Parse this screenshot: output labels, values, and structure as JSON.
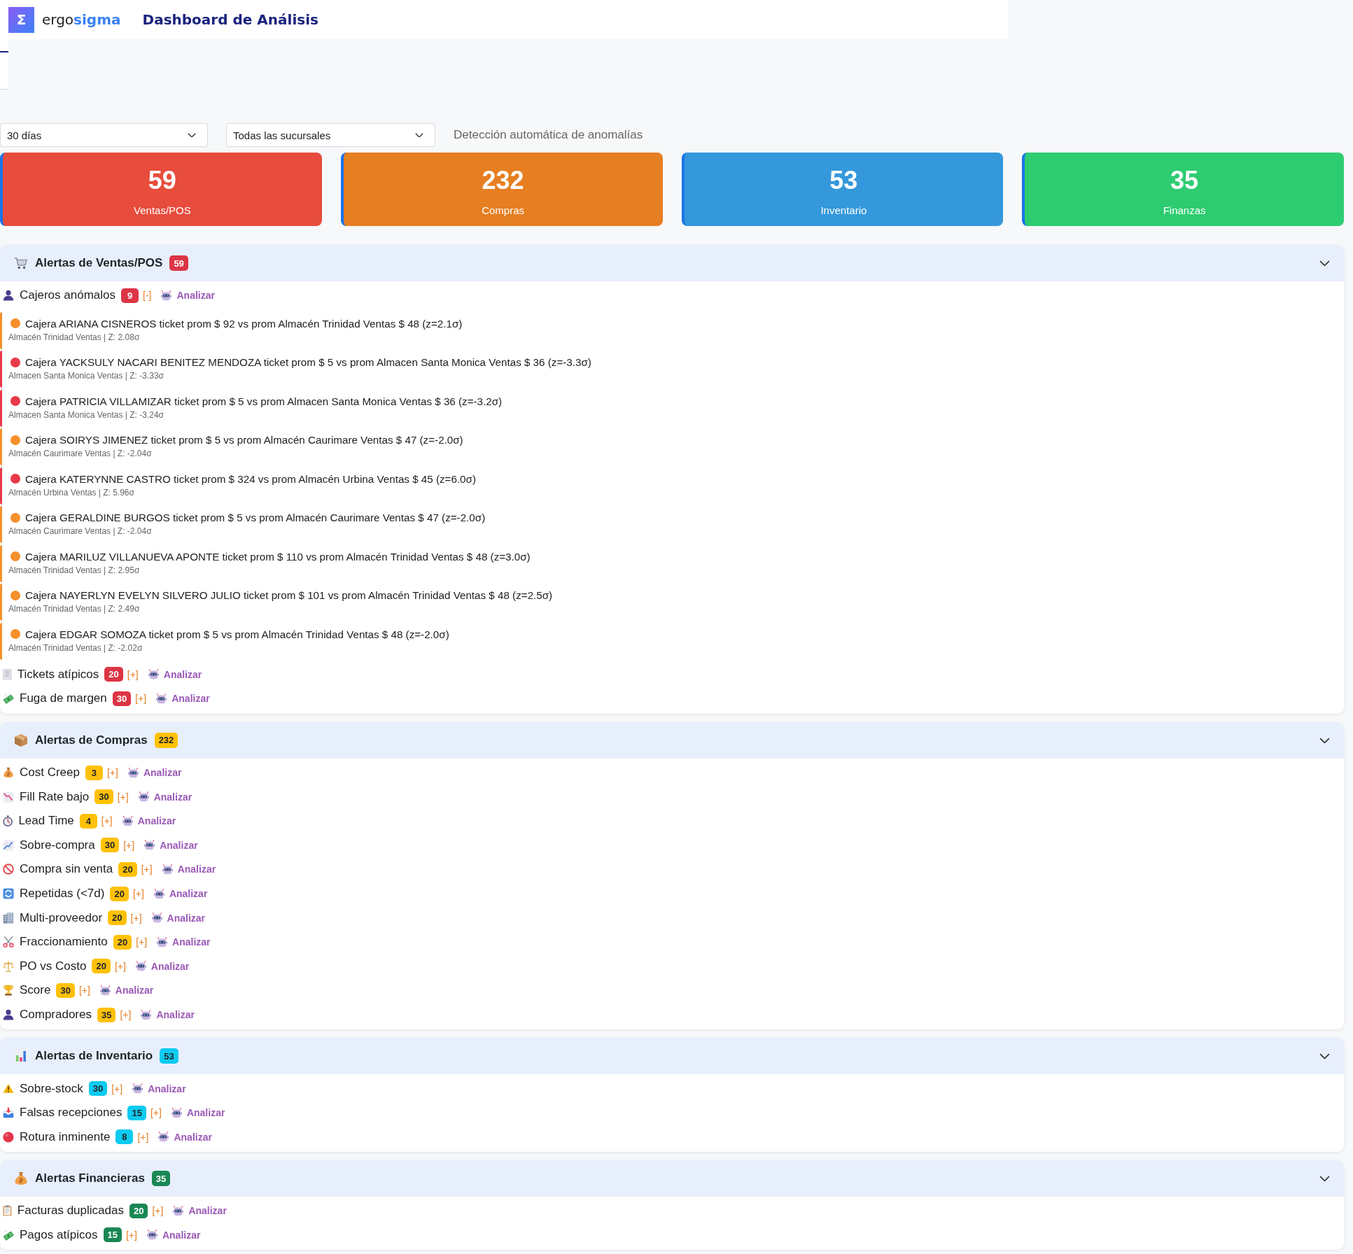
{
  "header": {
    "logo": "Σ",
    "brand_prefix": "ergo",
    "brand_suffix": "sigma",
    "title": "Dashboard de Análisis"
  },
  "filters": {
    "selects": [
      {
        "value": "30 días"
      },
      {
        "value": "Todas las sucursales"
      }
    ],
    "caption": "Detección automática de anomalías"
  },
  "summary_cards": [
    {
      "value": "59",
      "label": "Ventas/POS",
      "color": "#e74c3c"
    },
    {
      "value": "232",
      "label": "Compras",
      "color": "#e67e22"
    },
    {
      "value": "53",
      "label": "Inventario",
      "color": "#3498db"
    },
    {
      "value": "35",
      "label": "Finanzas",
      "color": "#2ecc71"
    }
  ],
  "sections": [
    {
      "title": "Alertas de Ventas/POS",
      "count": "59",
      "color": "#dc3545",
      "groups": [
        {
          "label": "Cajeros anómalos",
          "count": "9",
          "toggle": "[-]",
          "action": "Analizar",
          "items": [
            {
              "text": "Cajera ARIANA CISNEROS ticket prom $ 92 vs prom Almacén Trinidad Ventas $ 48 (z=2.1σ)",
              "detail": "Almacén Trinidad Ventas | Z: 2.08σ",
              "color": "#f5902c"
            },
            {
              "text": "Cajera YACKSULY NACARI BENITEZ MENDOZA ticket prom $ 5 vs prom Almacen Santa Monica Ventas $ 36 (z=-3.3σ)",
              "detail": "Almacen Santa Monica Ventas | Z: -3.33σ",
              "color": "#e8394a"
            },
            {
              "text": "Cajera PATRICIA VILLAMIZAR ticket prom $ 5 vs prom Almacen Santa Monica Ventas $ 36 (z=-3.2σ)",
              "detail": "Almacen Santa Monica Ventas | Z: -3.24σ",
              "color": "#e8394a"
            },
            {
              "text": "Cajera SOIRYS JIMENEZ ticket prom $ 5 vs prom Almacén Caurimare Ventas $ 47 (z=-2.0σ)",
              "detail": "Almacén Caurimare Ventas | Z: -2.04σ",
              "color": "#f5902c"
            },
            {
              "text": "Cajera KATERYNNE CASTRO ticket prom $ 324 vs prom Almacén Urbina Ventas $ 45 (z=6.0σ)",
              "detail": "Almacén Urbina Ventas | Z: 5.96σ",
              "color": "#e8394a"
            },
            {
              "text": "Cajera GERALDINE BURGOS ticket prom $ 5 vs prom Almacén Caurimare Ventas $ 47 (z=-2.0σ)",
              "detail": "Almacén Caurimare Ventas | Z: -2.04σ",
              "color": "#f5902c"
            },
            {
              "text": "Cajera MARILUZ VILLANUEVA APONTE ticket prom $ 110 vs prom Almacén Trinidad Ventas $ 48 (z=3.0σ)",
              "detail": "Almacén Trinidad Ventas | Z: 2.95σ",
              "color": "#f5902c"
            },
            {
              "text": "Cajera NAYERLYN EVELYN SILVERO JULIO ticket prom $ 101 vs prom Almacén Trinidad Ventas $ 48 (z=2.5σ)",
              "detail": "Almacén Trinidad Ventas | Z: 2.49σ",
              "color": "#f5902c"
            },
            {
              "text": "Cajera EDGAR SOMOZA ticket prom $ 5 vs prom Almacén Trinidad Ventas $ 48 (z=-2.0σ)",
              "detail": "Almacén Trinidad Ventas | Z: -2.02σ",
              "color": "#f5902c"
            }
          ]
        },
        {
          "label": "Tickets atípicos",
          "count": "20",
          "toggle": "[+]",
          "action": "Analizar"
        },
        {
          "label": "Fuga de margen",
          "count": "30",
          "toggle": "[+]",
          "action": "Analizar"
        }
      ]
    },
    {
      "title": "Alertas de Compras",
      "count": "232",
      "color": "#ffc107",
      "groups": [
        {
          "label": "Cost Creep",
          "count": "3",
          "toggle": "[+]",
          "action": "Analizar"
        },
        {
          "label": "Fill Rate bajo",
          "count": "30",
          "toggle": "[+]",
          "action": "Analizar"
        },
        {
          "label": "Lead Time",
          "count": "4",
          "toggle": "[+]",
          "action": "Analizar"
        },
        {
          "label": "Sobre-compra",
          "count": "30",
          "toggle": "[+]",
          "action": "Analizar"
        },
        {
          "label": "Compra sin venta",
          "count": "20",
          "toggle": "[+]",
          "action": "Analizar"
        },
        {
          "label": "Repetidas (<7d)",
          "count": "20",
          "toggle": "[+]",
          "action": "Analizar"
        },
        {
          "label": "Multi-proveedor",
          "count": "20",
          "toggle": "[+]",
          "action": "Analizar"
        },
        {
          "label": "Fraccionamiento",
          "count": "20",
          "toggle": "[+]",
          "action": "Analizar"
        },
        {
          "label": "PO vs Costo",
          "count": "20",
          "toggle": "[+]",
          "action": "Analizar"
        },
        {
          "label": "Score",
          "count": "30",
          "toggle": "[+]",
          "action": "Analizar"
        },
        {
          "label": "Compradores",
          "count": "35",
          "toggle": "[+]",
          "action": "Analizar"
        }
      ]
    },
    {
      "title": "Alertas de Inventario",
      "count": "53",
      "color": "#0dcaf0",
      "groups": [
        {
          "label": "Sobre-stock",
          "count": "30",
          "toggle": "[+]",
          "action": "Analizar"
        },
        {
          "label": "Falsas recepciones",
          "count": "15",
          "toggle": "[+]",
          "action": "Analizar"
        },
        {
          "label": "Rotura inminente",
          "count": "8",
          "toggle": "[+]",
          "action": "Analizar"
        }
      ]
    },
    {
      "title": "Alertas Financieras",
      "count": "35",
      "color": "#198754",
      "groups": [
        {
          "label": "Facturas duplicadas",
          "count": "20",
          "toggle": "[+]",
          "action": "Analizar"
        },
        {
          "label": "Pagos atípicos",
          "count": "15",
          "toggle": "[+]",
          "action": "Analizar"
        }
      ]
    }
  ]
}
